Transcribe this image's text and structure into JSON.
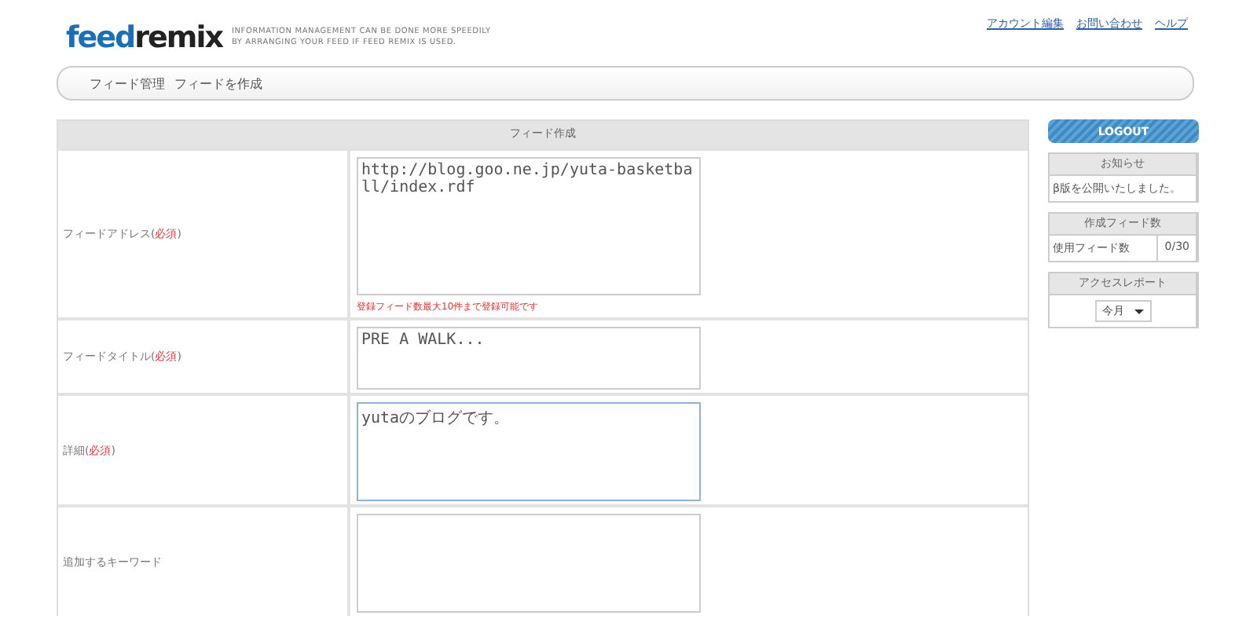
{
  "header": {
    "logo": {
      "first": "feed",
      "second": "remix"
    },
    "tagline": [
      "INFORMATION MANAGEMENT CAN BE DONE MORE SPEEDILY",
      "BY ARRANGING YOUR FEED IF FEED REMIX IS USED."
    ],
    "links": [
      "アカウント編集",
      "お問い合わせ",
      "ヘルプ"
    ]
  },
  "breadcrumb": [
    "フィード管理",
    "フィードを作成"
  ],
  "form": {
    "title": "フィード作成",
    "rows": [
      {
        "label": "フィードアドレス(",
        "required": "必須",
        "label_end": ")",
        "value": "http://blog.goo.ne.jp/yuta-basketball/index.rdf",
        "focused": false,
        "hint": "登録フィード数最大10件まで登録可能です"
      },
      {
        "label": "フィードタイトル(",
        "required": "必須",
        "label_end": ")",
        "value": "PRE A WALK...",
        "focused": false
      },
      {
        "label": "詳細(",
        "required": "必須",
        "label_end": ")",
        "value": "yutaのブログです。",
        "focused": true
      },
      {
        "label": "追加するキーワード",
        "value": "",
        "focused": false
      }
    ]
  },
  "sidebar": {
    "logout": "LOGOUT",
    "notice": {
      "title": "お知らせ",
      "text": "β版を公開いたしました。"
    },
    "count": {
      "title": "作成フィード数",
      "label": "使用フィード数",
      "value": "0/30"
    },
    "report": {
      "title": "アクセスレポート",
      "period": "今月"
    }
  }
}
